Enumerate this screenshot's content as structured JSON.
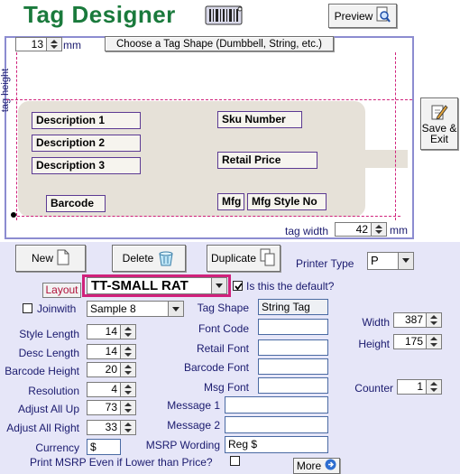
{
  "title": "Tag Designer",
  "logo_icon": "barcode-tag-icon",
  "preview_label": "Preview",
  "save_exit_line1": "Save &",
  "save_exit_line2": "Exit",
  "designer": {
    "height_value": "13",
    "unit": "mm",
    "shape_button": "Choose a Tag Shape (Dumbbell, String, etc.)",
    "tag_height_label": "tag height",
    "tag_width_label": "tag width",
    "width_value": "42",
    "fields": {
      "desc1": "Description 1",
      "desc2": "Description 2",
      "desc3": "Description 3",
      "barcode": "Barcode",
      "sku": "Sku Number",
      "retail": "Retail Price",
      "mfg": "Mfg",
      "mfg_style": "Mfg Style No"
    }
  },
  "toolbar": {
    "new": "New",
    "delete": "Delete",
    "duplicate": "Duplicate",
    "printer_type_label": "Printer Type",
    "printer_type_value": "P"
  },
  "layout": {
    "label": "Layout",
    "value": "TT-SMALL RAT",
    "default_label": "Is this the default?",
    "default_checked": true,
    "joinwith_label": "Joinwith",
    "joinwith_value": "Sample 8"
  },
  "settings": {
    "style_length_label": "Style Length",
    "style_length": "14",
    "desc_length_label": "Desc Length",
    "desc_length": "14",
    "barcode_height_label": "Barcode Height",
    "barcode_height": "20",
    "resolution_label": "Resolution",
    "resolution": "4",
    "adjust_up_label": "Adjust All Up",
    "adjust_up": "73",
    "adjust_right_label": "Adjust All Right",
    "adjust_right": "33",
    "currency_label": "Currency",
    "currency": "$"
  },
  "fonts": {
    "tag_shape_label": "Tag Shape",
    "tag_shape": "String Tag",
    "font_code_label": "Font Code",
    "retail_font_label": "Retail Font",
    "barcode_font_label": "Barcode Font",
    "msg_font_label": "Msg Font",
    "message1_label": "Message 1",
    "message2_label": "Message 2",
    "msrp_wording_label": "MSRP Wording",
    "msrp_wording": "Reg $",
    "print_msrp_label": "Print MSRP Even if Lower than Price?"
  },
  "dims": {
    "width_label": "Width",
    "width": "387",
    "height_label": "Height",
    "height": "175",
    "counter_label": "Counter",
    "counter": "1"
  },
  "more_label": "More",
  "colors": {
    "title_green": "#1a7a3c",
    "guide_magenta": "#d0217b",
    "label_navy": "#1a1a6e",
    "background": "#e6e6f8"
  }
}
